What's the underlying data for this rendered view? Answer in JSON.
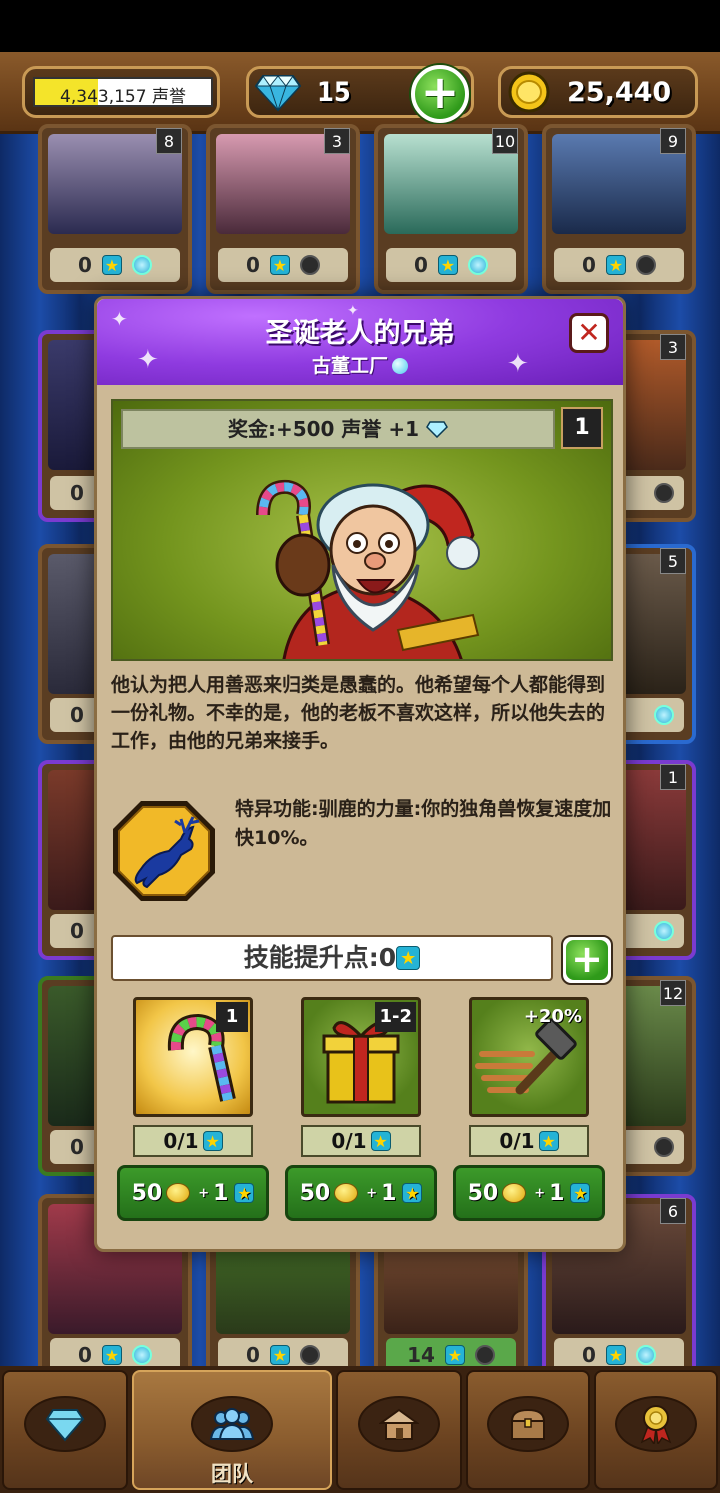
{
  "status": {
    "reputation_text": "4,343,157 声誉",
    "reputation_fill": 0.36,
    "gems": "15",
    "gold": "25,440"
  },
  "background_cards": [
    {
      "level": "8",
      "count": "0",
      "dot": "on"
    },
    {
      "level": "3",
      "count": "0",
      "dot": "off"
    },
    {
      "level": "10",
      "count": "0",
      "dot": "on"
    },
    {
      "level": "9",
      "count": "0",
      "dot": "off"
    }
  ],
  "side_cards": {
    "left": [
      {
        "count": "0"
      },
      {
        "count": "0"
      },
      {
        "count": "0"
      },
      {
        "count": "0"
      }
    ],
    "right": [
      {
        "level": "3"
      },
      {
        "level": "5"
      },
      {
        "level": "1"
      },
      {
        "level": "12"
      }
    ],
    "bottom": [
      {
        "count": "0",
        "dot": "on"
      },
      {
        "count": "0",
        "dot": "off"
      },
      {
        "count": "14",
        "dot": "off"
      },
      {
        "level": "6",
        "count": "0",
        "dot": "on"
      }
    ]
  },
  "modal": {
    "title": "圣诞老人的兄弟",
    "subtitle": "古董工厂",
    "bonus": "奖金:+500 声誉 +1",
    "level": "1",
    "description": "他认为把人用善恶来归类是愚蠢的。他希望每个人都能得到一份礼物。不幸的是，他的老板不喜欢这样，所以他失去的工作，由他的兄弟来接手。",
    "ability": "特异功能:驯鹿的力量:你的独角兽恢复速度加快10%。",
    "skill_points": "技能提升点:0",
    "skills": [
      {
        "icon": "candy-cane-icon",
        "badge": "1",
        "progress": "0/1",
        "cost": "50",
        "star_cost": "1"
      },
      {
        "icon": "gift-box-icon",
        "badge": "1-2",
        "progress": "0/1",
        "cost": "50",
        "star_cost": "1"
      },
      {
        "icon": "hammer-icon",
        "badge": "+20%",
        "progress": "0/1",
        "cost": "50",
        "star_cost": "1"
      }
    ]
  },
  "nav": {
    "tabs": [
      {
        "icon": "gem-icon",
        "label": ""
      },
      {
        "icon": "team-icon",
        "label": "团队"
      },
      {
        "icon": "house-icon",
        "label": ""
      },
      {
        "icon": "chest-icon",
        "label": ""
      },
      {
        "icon": "medal-icon",
        "label": ""
      }
    ]
  },
  "colors": {
    "header_purple": "#8f3be0",
    "button_green": "#2f9a1a",
    "wood_brown": "#6e431c"
  }
}
